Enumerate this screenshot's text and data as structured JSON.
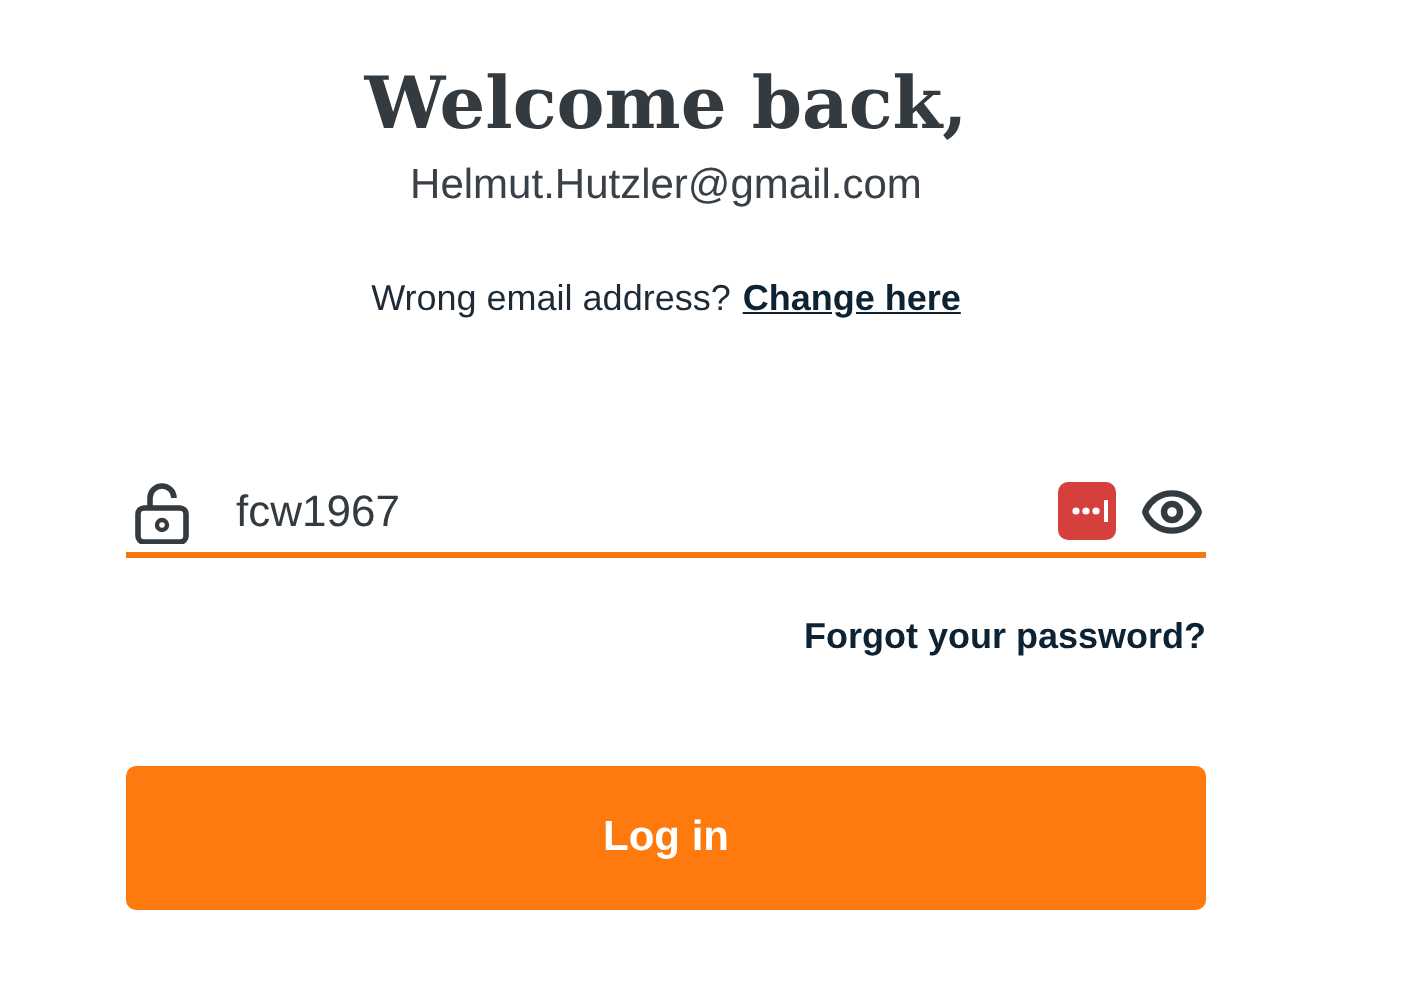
{
  "heading": "Welcome back,",
  "email": "Helmut.Hutzler@gmail.com",
  "wrong_email": {
    "text": "Wrong email address?",
    "link": "Change here"
  },
  "password": {
    "value": "fcw1967",
    "focused": true
  },
  "forgot_link": "Forgot your password?",
  "login_button": "Log in"
}
